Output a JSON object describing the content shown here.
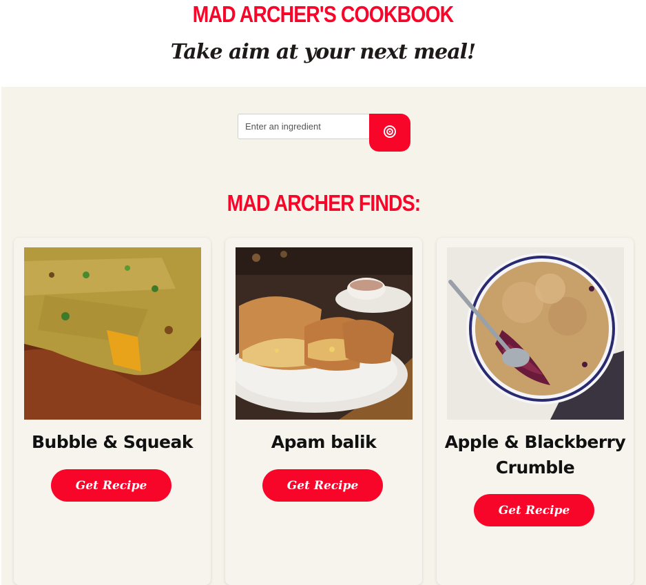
{
  "header": {
    "title": "MAD ARCHER'S COOKBOOK",
    "tagline": "Take aim at your next meal!"
  },
  "search": {
    "placeholder": "Enter an ingredient",
    "value": "",
    "button_icon": "target-icon"
  },
  "results": {
    "heading": "MAD ARCHER FINDS:",
    "cards": [
      {
        "title": "Bubble & Squeak",
        "button_label": "Get Recipe",
        "image": "bubble-and-squeak-photo"
      },
      {
        "title": "Apam balik",
        "button_label": "Get Recipe",
        "image": "apam-balik-photo"
      },
      {
        "title": "Apple & Blackberry Crumble",
        "button_label": "Get Recipe",
        "image": "apple-blackberry-crumble-photo"
      }
    ]
  },
  "colors": {
    "accent": "#f8052a",
    "page_background": "#f5f3ea",
    "text": "#1e1a1a"
  }
}
